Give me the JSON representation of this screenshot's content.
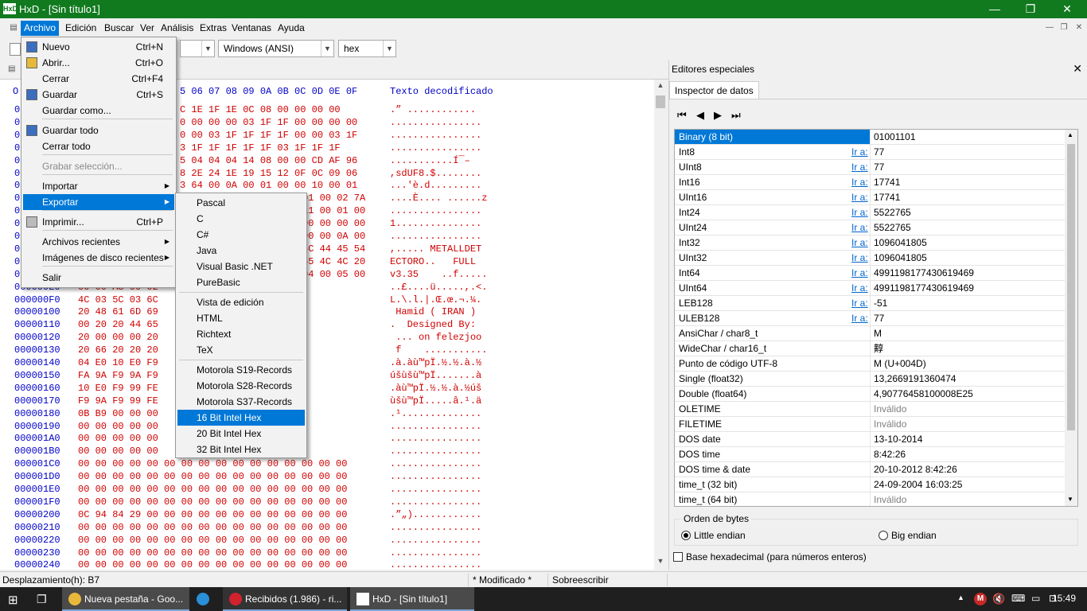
{
  "window": {
    "title": "HxD - [Sin título1]",
    "logo": "HxD"
  },
  "menubar": [
    "Archivo",
    "Edición",
    "Buscar",
    "Ver",
    "Análisis",
    "Extras",
    "Ventanas",
    "Ayuda"
  ],
  "toolbar": {
    "charset": "Windows (ANSI)",
    "mode": "hex"
  },
  "hex": {
    "header": "5 06 07 08 09 0A 0B 0C 0D 0E 0F",
    "header_o": "O",
    "header_text": "Texto decodificado",
    "rows": [
      {
        "off": "0",
        "bytes": "C 1E 1F 1E 0C 08 00 00 00 00",
        "txt": ".” ............"
      },
      {
        "off": "0",
        "bytes": "0 00 00 00 03 1F 1F 00 00 00 00",
        "txt": "................"
      },
      {
        "off": "0",
        "bytes": "0 00 03 1F 1F 1F 1F 00 00 03 1F",
        "txt": "................"
      },
      {
        "off": "0",
        "bytes": "3 1F 1F 1F 1F 1F 03 1F 1F 1F",
        "txt": "................"
      },
      {
        "off": "0",
        "bytes": "5 04 04 04 14 08 00 00 CD AF 96",
        "txt": "...........Í¯–"
      },
      {
        "off": "0",
        "bytes": "8 2E 24 1E 19 15 12 0F 0C 09 06",
        "txt": ",sdUF8.$........"
      },
      {
        "off": "0",
        "bytes": "3 64 00 0A 00 01 00 00 10 00 01",
        "txt": "...'è.d........."
      },
      {
        "off": "0",
        "bytes": "01 00 02 7A",
        "txt": "....È.... ......z"
      },
      {
        "off": "0",
        "bytes": "11 00 01 00",
        "txt": "................"
      },
      {
        "off": "0",
        "bytes": "00 00 00 00",
        "txt": "1..............."
      },
      {
        "off": "0",
        "bytes": "00 00 0A 00",
        "txt": "................"
      },
      {
        "off": "0",
        "bytes": "4C 44 45 54",
        "txt": ",..... METALLDET"
      },
      {
        "off": "0",
        "bytes": "55 4C 4C 20",
        "txt": "ECTORO..   FULL"
      },
      {
        "off": "0",
        "bytes": "04 00 05 00",
        "txt": "v3.35    ..f....."
      },
      {
        "off": "000000E0",
        "bytes": "00 00 A3 00 02          2C 03 3C 03",
        "txt": "..£....ü.....,.<."
      },
      {
        "off": "000000F0",
        "bytes": "4C 03 5C 03 6C          AC 03 BC 03",
        "txt": "L.\\.l.|.Œ.œ.¬.¼."
      },
      {
        "off": "00000100",
        "bytes": "20 48 61 6D 69          4E 20 29 20",
        "txt": " Hamid ( IRAN ) "
      },
      {
        "off": "00000110",
        "bytes": "00 20 20 44 65          42 79 3A 20",
        "txt": ".  Designed By: "
      },
      {
        "off": "00000120",
        "bytes": "20 00 00 00 20          7A 6A 6F 6F",
        "txt": " ... on felezjoo"
      },
      {
        "off": "00000130",
        "bytes": "20 66 20 20 20          00 00 00 00",
        "txt": " f    ..........."
      },
      {
        "off": "00000140",
        "bytes": "04 E0 10 E0 F9          08 E0 00 BD",
        "txt": ".à.àù™pÏ.½.½.à.½"
      },
      {
        "off": "00000150",
        "bytes": "FA 9A F9 9A F9          00 05 E0",
        "txt": "úšùšù™pÏ.......à"
      },
      {
        "off": "00000160",
        "bytes": "10 E0 F9 99 FE          00 BD FA 9A",
        "txt": ".àù™pÏ.½.½.à.½úš"
      },
      {
        "off": "00000170",
        "bytes": "F9 9A F9 99 FE          05 B9 00 E4",
        "txt": "ùšù™pÏ.....â.¹.ä"
      },
      {
        "off": "00000180",
        "bytes": "0B B9 00 00 00          00 00 00 00",
        "txt": ".¹.............."
      },
      {
        "off": "00000190",
        "bytes": "00 00 00 00 00          00 00 00 00",
        "txt": "................"
      },
      {
        "off": "000001A0",
        "bytes": "00 00 00 00 00          00 00 00 00",
        "txt": "................"
      },
      {
        "off": "000001B0",
        "bytes": "00 00 00 00 00          00 00 00 00",
        "txt": "................"
      },
      {
        "off": "000001C0",
        "bytes": "00 00 00 00 00 00 00 00 00 00 00 00 00 00 00 00",
        "txt": "................"
      },
      {
        "off": "000001D0",
        "bytes": "00 00 00 00 00 00 00 00 00 00 00 00 00 00 00 00",
        "txt": "................"
      },
      {
        "off": "000001E0",
        "bytes": "00 00 00 00 00 00 00 00 00 00 00 00 00 00 00 00",
        "txt": "................"
      },
      {
        "off": "000001F0",
        "bytes": "00 00 00 00 00 00 00 00 00 00 00 00 00 00 00 00",
        "txt": "................"
      },
      {
        "off": "00000200",
        "bytes": "0C 94 84 29 00 00 00 00 00 00 00 00 00 00 00 00",
        "txt": ".”„)............"
      },
      {
        "off": "00000210",
        "bytes": "00 00 00 00 00 00 00 00 00 00 00 00 00 00 00 00",
        "txt": "................"
      },
      {
        "off": "00000220",
        "bytes": "00 00 00 00 00 00 00 00 00 00 00 00 00 00 00 00",
        "txt": "................"
      },
      {
        "off": "00000230",
        "bytes": "00 00 00 00 00 00 00 00 00 00 00 00 00 00 00 00",
        "txt": "................"
      },
      {
        "off": "00000240",
        "bytes": "00 00 00 00 00 00 00 00 00 00 00 00 00 00 00 00",
        "txt": "................"
      }
    ]
  },
  "archivo_menu": [
    {
      "label": "Nuevo",
      "shortcut": "Ctrl+N"
    },
    {
      "label": "Abrir...",
      "shortcut": "Ctrl+O"
    },
    {
      "label": "Cerrar",
      "shortcut": "Ctrl+F4"
    },
    {
      "label": "Guardar",
      "shortcut": "Ctrl+S"
    },
    {
      "label": "Guardar como...",
      "shortcut": ""
    },
    {
      "label": "Guardar todo",
      "shortcut": ""
    },
    {
      "label": "Cerrar todo",
      "shortcut": ""
    },
    {
      "label": "Grabar selección...",
      "shortcut": ""
    },
    {
      "label": "Importar",
      "shortcut": ""
    },
    {
      "label": "Exportar",
      "shortcut": ""
    },
    {
      "label": "Imprimir...",
      "shortcut": "Ctrl+P"
    },
    {
      "label": "Archivos recientes",
      "shortcut": ""
    },
    {
      "label": "Imágenes de disco recientes",
      "shortcut": ""
    },
    {
      "label": "Salir",
      "shortcut": ""
    }
  ],
  "exportar_menu": [
    "Pascal",
    "C",
    "C#",
    "Java",
    "Visual Basic .NET",
    "PureBasic",
    "Vista de edición",
    "HTML",
    "Richtext",
    "TeX",
    "Motorola S19-Records",
    "Motorola S28-Records",
    "Motorola S37-Records",
    "16 Bit Intel Hex",
    "20 Bit Intel Hex",
    "32 Bit Intel Hex"
  ],
  "right_panel": {
    "title": "Editores especiales",
    "tab": "Inspector de datos",
    "goto": "Ir a:",
    "rows": [
      {
        "name": "Binary (8 bit)",
        "value": "01001101",
        "goto": false
      },
      {
        "name": "Int8",
        "value": "77",
        "goto": true
      },
      {
        "name": "UInt8",
        "value": "77",
        "goto": true
      },
      {
        "name": "Int16",
        "value": "17741",
        "goto": true
      },
      {
        "name": "UInt16",
        "value": "17741",
        "goto": true
      },
      {
        "name": "Int24",
        "value": "5522765",
        "goto": true
      },
      {
        "name": "UInt24",
        "value": "5522765",
        "goto": true
      },
      {
        "name": "Int32",
        "value": "1096041805",
        "goto": true
      },
      {
        "name": "UInt32",
        "value": "1096041805",
        "goto": true
      },
      {
        "name": "Int64",
        "value": "4991198177430619469",
        "goto": true
      },
      {
        "name": "UInt64",
        "value": "4991198177430619469",
        "goto": true
      },
      {
        "name": "LEB128",
        "value": "-51",
        "goto": true
      },
      {
        "name": "ULEB128",
        "value": "77",
        "goto": true
      },
      {
        "name": "AnsiChar / char8_t",
        "value": "M",
        "goto": false
      },
      {
        "name": "WideChar / char16_t",
        "value": "䵍",
        "goto": false
      },
      {
        "name": "Punto de código UTF-8",
        "value": "M (U+004D)",
        "goto": false
      },
      {
        "name": "Single (float32)",
        "value": "13,2669191360474",
        "goto": false
      },
      {
        "name": "Double (float64)",
        "value": "4,90776458100008E25",
        "goto": false
      },
      {
        "name": "OLETIME",
        "value": "Inválido",
        "goto": false,
        "dim": true
      },
      {
        "name": "FILETIME",
        "value": "Inválido",
        "goto": false,
        "dim": true
      },
      {
        "name": "DOS date",
        "value": "13-10-2014",
        "goto": false
      },
      {
        "name": "DOS time",
        "value": "8:42:26",
        "goto": false
      },
      {
        "name": "DOS time & date",
        "value": "20-10-2012 8:42:26",
        "goto": false
      },
      {
        "name": "time_t (32 bit)",
        "value": "24-09-2004 16:03:25",
        "goto": false
      },
      {
        "name": "time_t (64 bit)",
        "value": "Inválido",
        "goto": false,
        "dim": true
      }
    ],
    "byte_order": {
      "legend": "Orden de bytes",
      "little": "Little endian",
      "big": "Big endian"
    },
    "hex_base": "Base hexadecimal (para números enteros)"
  },
  "status": {
    "offset": "Desplazamiento(h): B7",
    "modified": "* Modificado *",
    "mode": "Sobreescribir"
  },
  "taskbar": {
    "items": [
      "Nueva pestaña - Goo...",
      "Recibidos (1.986) - ri...",
      "HxD - [Sin título1]"
    ],
    "time": "15:49"
  },
  "colors": {
    "title": "#117a1f",
    "accent": "#0078d7",
    "hex_bytes": "#d00000",
    "hex_offsets": "#0000c8"
  }
}
